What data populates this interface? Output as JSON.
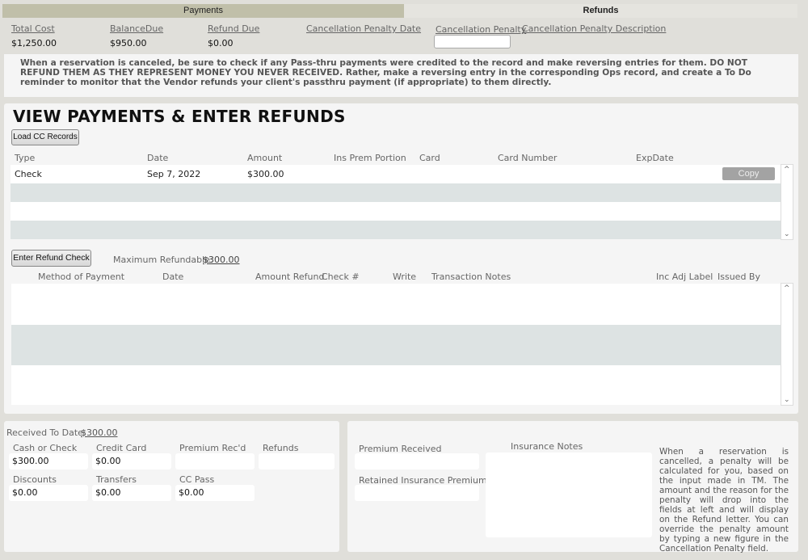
{
  "tabs": {
    "payments": "Payments",
    "refunds": "Refunds"
  },
  "summary": {
    "total_cost_label": "Total Cost",
    "total_cost": "$1,250.00",
    "balance_due_label": "BalanceDue",
    "balance_due": "$950.00",
    "refund_due_label": "Refund Due",
    "refund_due": "$0.00",
    "penalty_date_label": "Cancellation Penalty Date",
    "penalty_label": "Cancellation Penalty",
    "penalty_value": "",
    "penalty_desc_label": "Cancellation Penalty Description"
  },
  "notice": "When a reservation is canceled, be sure to check if any Pass-thru payments were credited to the record and make reversing entries for them.  DO NOT REFUND THEM AS THEY REPRESENT MONEY YOU NEVER RECEIVED.  Rather, make a reversing entry in the corresponding Ops record, and create a To Do reminder to monitor that the Vendor refunds your client's passthru payment (if appropriate) to them directly.",
  "main": {
    "title": "VIEW PAYMENTS & ENTER REFUNDS",
    "load_cc": "Load CC Records",
    "payments_columns": [
      "Type",
      "Date",
      "Amount",
      "Ins Prem Portion",
      "Card",
      "Card Number",
      "ExpDate"
    ],
    "payments_rows": [
      {
        "type": "Check",
        "date": "Sep 7, 2022",
        "amount": "$300.00",
        "copy": "Copy"
      }
    ],
    "enter_refund": "Enter Refund Check",
    "max_refundable_label": "Maximum Refundable:",
    "max_refundable": "$300.00",
    "refund_columns": [
      "Method of Payment",
      "Date",
      "Amount Refund",
      "Check #",
      "Write",
      "Transaction Notes",
      "Inc Adj Label",
      "Issued By"
    ]
  },
  "received": {
    "label": "Received To Date:",
    "value": "$300.00",
    "fields": [
      {
        "label": "Cash or Check",
        "value": "$300.00"
      },
      {
        "label": "Credit Card",
        "value": "$0.00"
      },
      {
        "label": "Premium Rec'd",
        "value": ""
      },
      {
        "label": "Refunds",
        "value": ""
      },
      {
        "label": "Discounts",
        "value": "$0.00"
      },
      {
        "label": "Transfers",
        "value": "$0.00"
      },
      {
        "label": "CC Pass",
        "value": "$0.00"
      }
    ]
  },
  "insurance": {
    "premium_received": "Premium Received",
    "retained": "Retained Insurance Premium",
    "notes_label": "Insurance Notes",
    "help": "When a reservation is cancelled, a penalty will be calculated for you, based on the input made in TM.  The amount and the reason for the penalty will drop into the fields at left and will display on the Refund letter.   You can override the penalty amount by typing a new figure in the Cancellation Penalty field."
  }
}
